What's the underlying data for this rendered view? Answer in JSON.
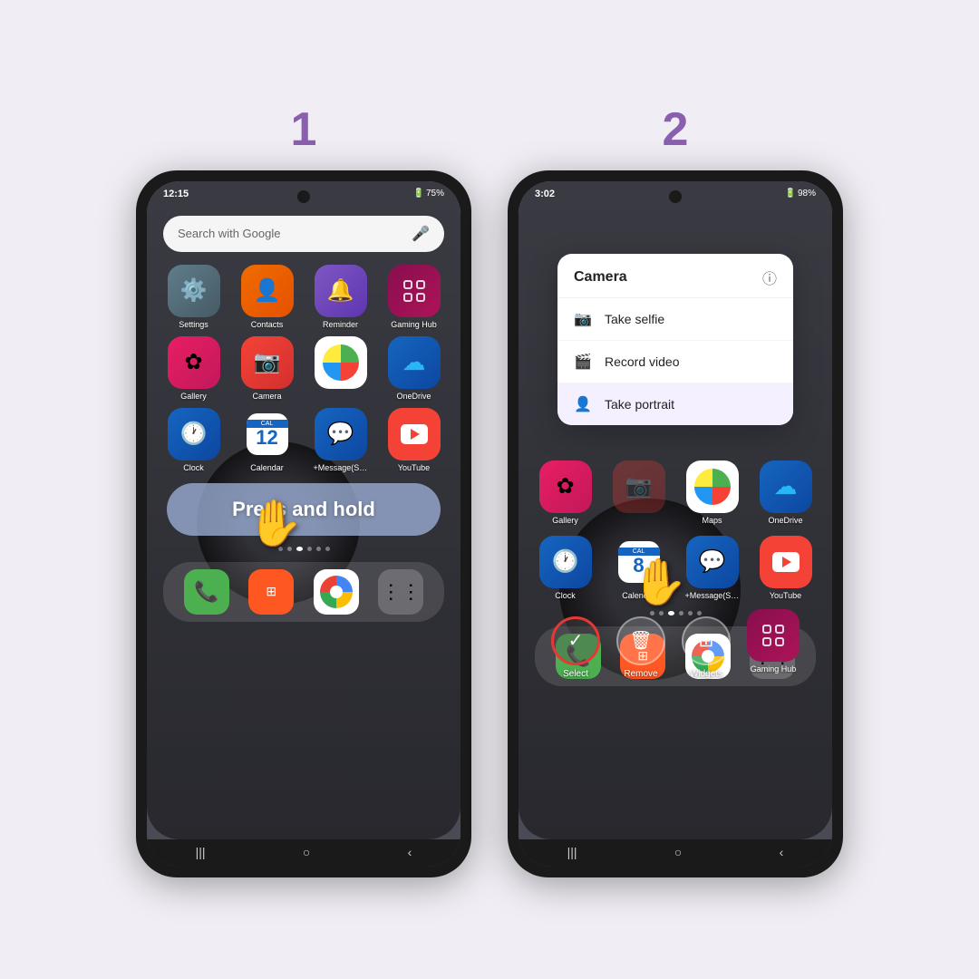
{
  "page": {
    "background": "#f0eef4",
    "step1": {
      "number": "1",
      "time": "12:15",
      "battery": "75%",
      "search_placeholder": "Search with Google",
      "press_hold_text": "Press and hold",
      "apps_row1": [
        {
          "name": "Settings",
          "type": "settings"
        },
        {
          "name": "Contacts",
          "type": "contacts"
        },
        {
          "name": "Reminder",
          "type": "reminder"
        },
        {
          "name": "Gaming Hub",
          "type": "gaming"
        }
      ],
      "apps_row2": [
        {
          "name": "Gallery",
          "type": "gallery"
        },
        {
          "name": "Camera",
          "type": "camera"
        },
        {
          "name": "",
          "type": "empty"
        },
        {
          "name": "OneDrive",
          "type": "onedrive"
        }
      ],
      "apps_row3": [
        {
          "name": "Clock",
          "type": "clock"
        },
        {
          "name": "Calendar",
          "type": "calendar"
        },
        {
          "name": "+Message(SM...",
          "type": "message"
        },
        {
          "name": "YouTube",
          "type": "youtube"
        }
      ]
    },
    "step2": {
      "number": "2",
      "time": "3:02",
      "battery": "98%",
      "context_menu": {
        "title": "Camera",
        "items": [
          "Take selfie",
          "Record video",
          "Take portrait"
        ]
      },
      "actions": [
        "Select",
        "Remove",
        "Widgets"
      ],
      "apps_row1": [
        {
          "name": "Gallery",
          "type": "gallery"
        },
        {
          "name": "",
          "type": "empty"
        },
        {
          "name": "Maps",
          "type": "maps"
        },
        {
          "name": "OneDrive",
          "type": "onedrive"
        }
      ],
      "apps_row2": [
        {
          "name": "Clock",
          "type": "clock"
        },
        {
          "name": "Calendar",
          "type": "calendar"
        },
        {
          "name": "+Message(SM...",
          "type": "message"
        },
        {
          "name": "YouTube",
          "type": "youtube"
        }
      ],
      "gaming_app": {
        "name": "Gaming Hub",
        "type": "gaming"
      }
    }
  }
}
